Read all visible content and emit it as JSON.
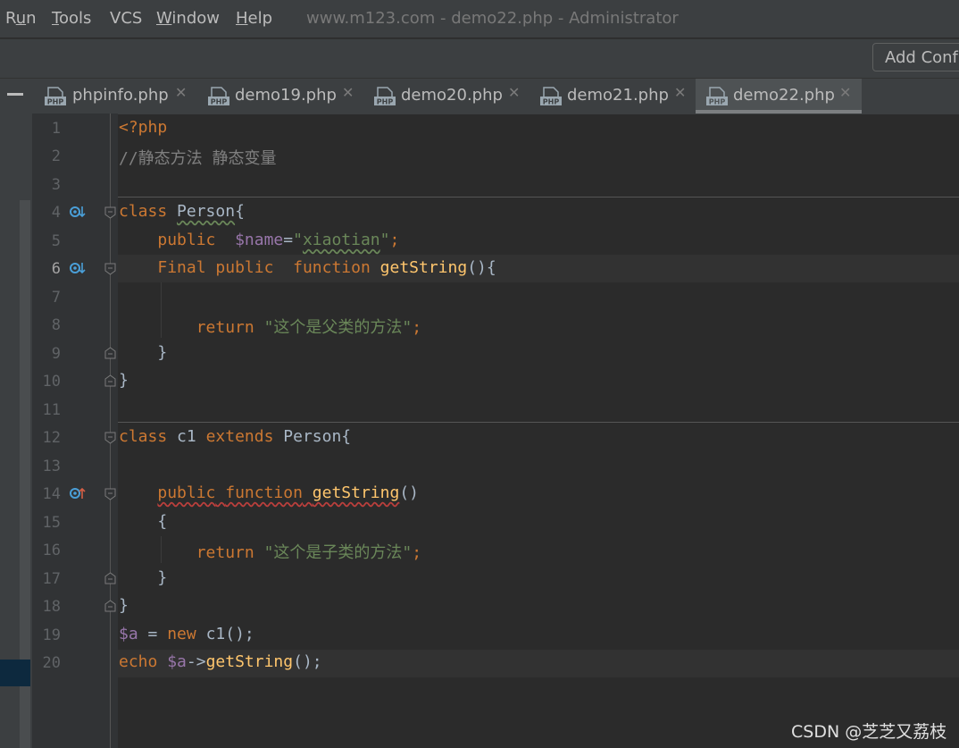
{
  "menu": {
    "items": [
      {
        "label": "Run"
      },
      {
        "label": "Tools"
      },
      {
        "label": "VCS"
      },
      {
        "label": "Window"
      },
      {
        "label": "Help"
      }
    ],
    "window_title": "www.m123.com - demo22.php - Administrator"
  },
  "toolbar": {
    "add_config_label": "Add Conf"
  },
  "tabs": [
    {
      "label": "phpinfo.php",
      "icon": "php-file-icon",
      "active": false
    },
    {
      "label": "demo19.php",
      "icon": "php-file-icon",
      "active": false
    },
    {
      "label": "demo20.php",
      "icon": "php-file-icon",
      "active": false
    },
    {
      "label": "demo21.php",
      "icon": "php-file-icon",
      "active": false
    },
    {
      "label": "demo22.php",
      "icon": "php-file-icon",
      "active": true
    }
  ],
  "editor": {
    "current_line": 6,
    "line_numbers": [
      "1",
      "2",
      "3",
      "4",
      "5",
      "6",
      "7",
      "8",
      "9",
      "10",
      "11",
      "12",
      "13",
      "14",
      "15",
      "16",
      "17",
      "18",
      "19",
      "20"
    ],
    "code": {
      "l1": "<?php",
      "l2": "//静态方法 静态变量",
      "l4_kw": "class",
      "l4_name": "Person",
      "l4_brace": "{",
      "l5_kw": "public",
      "l5_var": "$name",
      "l5_eq": "=",
      "l5_q1": "\"",
      "l5_str": "xiaotian",
      "l5_q2": "\"",
      "l5_semi": ";",
      "l6_kw1": "Final",
      "l6_kw2": "public",
      "l6_kw3": "function",
      "l6_fn": "getString",
      "l6_rest": "(){",
      "l8_kw": "return",
      "l8_str": "\"这个是父类的方法\"",
      "l8_semi": ";",
      "l9": "}",
      "l10": "}",
      "l12_kw1": "class",
      "l12_name": "c1",
      "l12_kw2": "extends",
      "l12_parent": "Person",
      "l12_brace": "{",
      "l14_kw1": "public",
      "l14_kw2": "function",
      "l14_fn": "getString",
      "l14_rest": "()",
      "l15": "{",
      "l16_kw": "return",
      "l16_str": "\"这个是子类的方法\"",
      "l16_semi": ";",
      "l17": "}",
      "l18": "}",
      "l19_var": "$a",
      "l19_eq": "=",
      "l19_kw": "new",
      "l19_rest": "c1();",
      "l20_kw": "echo",
      "l20_var": "$a",
      "l20_arrow": "->",
      "l20_fn": "getString",
      "l20_rest": "();"
    }
  },
  "watermark": "CSDN @芝芝又荔枝",
  "colors": {
    "background": "#2b2b2b",
    "gutter": "#313335",
    "keyword": "#cc7832",
    "string": "#6a8759",
    "variable": "#9876aa",
    "function": "#ffc66d",
    "comment": "#808080",
    "marker": "#4a9fd8",
    "override_marker": "#d35f46"
  }
}
